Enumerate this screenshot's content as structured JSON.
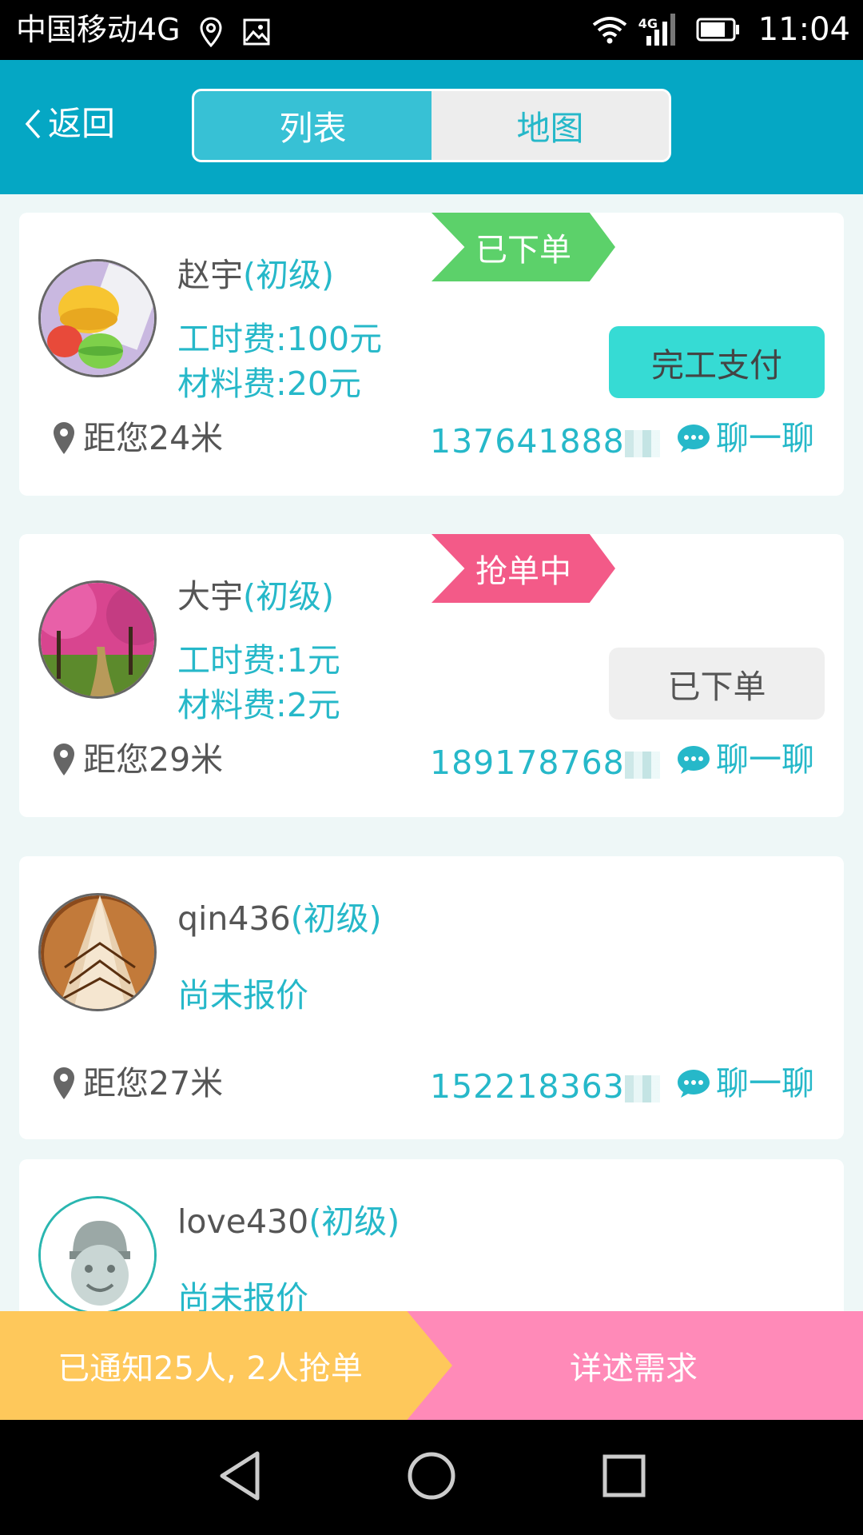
{
  "status_bar": {
    "carrier": "中国移动4G",
    "network": "4G",
    "time": "11:04"
  },
  "header": {
    "back_label": "返回",
    "tabs": [
      "列表",
      "地图"
    ],
    "active_tab": "列表"
  },
  "cards": [
    {
      "name": "赵宇",
      "level": "(初级)",
      "tag": "已下单",
      "tag_color": "#5cd16a",
      "labor_fee": "工时费:100元",
      "material_fee": "材料费:20元",
      "action": "完工支付",
      "distance": "距您24米",
      "phone": "137641888",
      "chat": "聊一聊"
    },
    {
      "name": "大宇",
      "level": "(初级)",
      "tag": "抢单中",
      "tag_color": "#f35a88",
      "labor_fee": "工时费:1元",
      "material_fee": "材料费:2元",
      "action": "已下单",
      "distance": "距您29米",
      "phone": "189178768",
      "chat": "聊一聊"
    },
    {
      "name": "qin436",
      "level": "(初级)",
      "quote_status": "尚未报价",
      "distance": "距您27米",
      "phone": "152218363",
      "chat": "聊一聊"
    },
    {
      "name": "love430",
      "level": "(初级)",
      "quote_status": "尚未报价"
    }
  ],
  "bottom_bar": {
    "notice": "已通知25人, 2人抢单",
    "detail_button": "详述需求"
  },
  "colors": {
    "header": "#05a7c4",
    "accent": "#26b8c9",
    "notice": "#fec85b",
    "detail": "#ff8ab8"
  },
  "icons": [
    "location-pin-icon",
    "gallery-icon",
    "wifi-icon",
    "signal-icon",
    "battery-icon",
    "back-chevron-icon",
    "map-pin-icon",
    "chat-bubble-icon",
    "nav-back-icon",
    "nav-home-icon",
    "nav-recent-icon"
  ]
}
